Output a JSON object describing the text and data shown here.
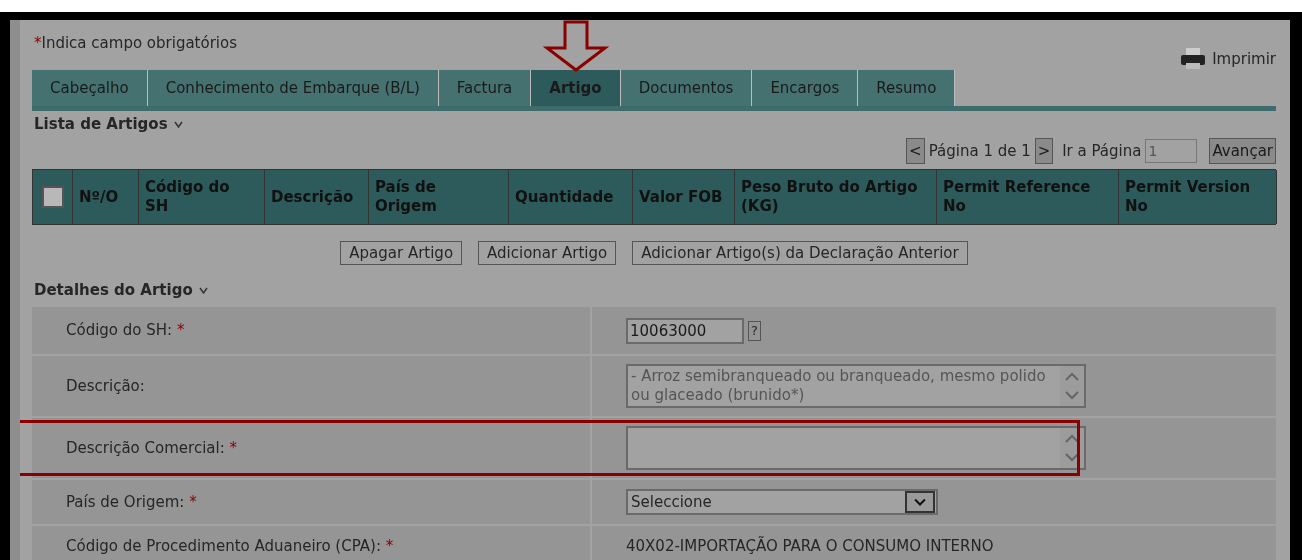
{
  "required_note": {
    "mark": "*",
    "text": "Indica campo obrigatórios"
  },
  "print_link": "Imprimir",
  "tabs": [
    {
      "label": "Cabeçalho",
      "selected": false,
      "pointed": false
    },
    {
      "label": "Conhecimento de Embarque (B/L)",
      "selected": false,
      "pointed": false
    },
    {
      "label": "Factura",
      "selected": false,
      "pointed": false
    },
    {
      "label": "Artigo",
      "selected": true,
      "pointed": true
    },
    {
      "label": "Documentos",
      "selected": false,
      "pointed": false
    },
    {
      "label": "Encargos",
      "selected": false,
      "pointed": false
    },
    {
      "label": "Resumo",
      "selected": false,
      "pointed": false
    }
  ],
  "list_section": {
    "title": "Lista de Artigos",
    "expanded": true
  },
  "pagination": {
    "prev": "<",
    "page_text": "Página 1 de 1",
    "next": ">",
    "goto_label": "Ir a Página",
    "goto_value": "1",
    "go_button": "Avançar"
  },
  "table": {
    "select_all_checked": false,
    "columns": [
      "Nº/O",
      "Código do SH",
      "Descrição",
      "País de Origem",
      "Quantidade",
      "Valor FOB",
      "Peso Bruto do Artigo (KG)",
      "Permit Reference No",
      "Permit Version No"
    ]
  },
  "actions": [
    "Apagar Artigo",
    "Adicionar Artigo",
    "Adicionar Artigo(s) da Declaração Anterior"
  ],
  "details_section": {
    "title": "Detalhes do Artigo",
    "expanded": true
  },
  "fields": [
    {
      "kind": "code",
      "label": "Código do SH:",
      "required": true,
      "value": "10063000",
      "help": "?",
      "highlighted": false
    },
    {
      "kind": "textarea",
      "label": "Descrição:",
      "required": false,
      "value": "- Arroz semibranqueado ou branqueado, mesmo polido ou glaceado (brunido*)",
      "disabled": true,
      "highlighted": false
    },
    {
      "kind": "textarea",
      "label": "Descrição Comercial:",
      "required": true,
      "disabled": false,
      "highlighted": true
    },
    {
      "kind": "select",
      "label": "País de Origem:",
      "required": true,
      "value": "Seleccione",
      "highlighted": false
    },
    {
      "kind": "text",
      "label": "Código de Procedimento Aduaneiro (CPA):",
      "required": true,
      "value": "40X02-IMPORTAÇÃO PARA O CONSUMO INTERNO",
      "highlighted": false
    }
  ]
}
